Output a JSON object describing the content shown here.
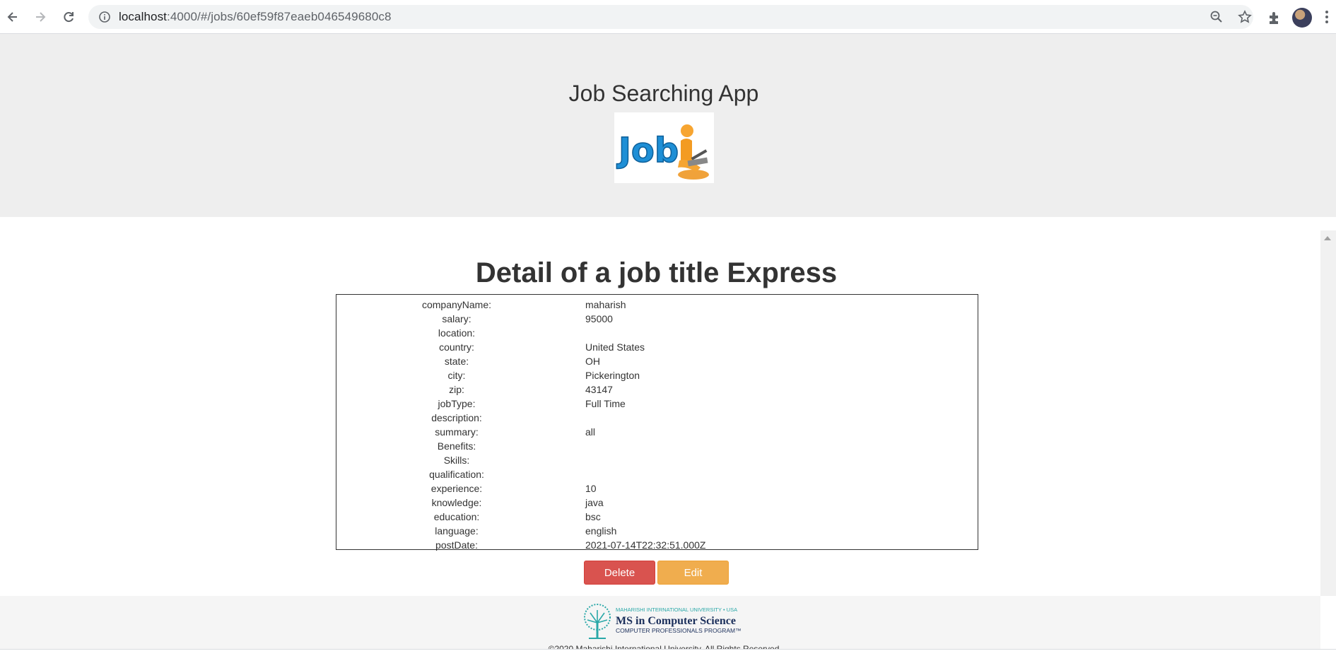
{
  "browser": {
    "url_host": "localhost",
    "url_path": ":4000/#/jobs/60ef59f87eaeb046549680c8"
  },
  "header": {
    "title": "Job Searching App",
    "logo_text": "Job"
  },
  "main": {
    "heading": "Detail of a job title Express",
    "fields": [
      {
        "label": "companyName:",
        "value": "maharish"
      },
      {
        "label": "salary:",
        "value": "95000"
      },
      {
        "label": "location:",
        "value": ""
      },
      {
        "label": "country:",
        "value": "United States"
      },
      {
        "label": "state:",
        "value": "OH"
      },
      {
        "label": "city:",
        "value": "Pickerington"
      },
      {
        "label": "zip:",
        "value": "43147"
      },
      {
        "label": "jobType:",
        "value": "Full Time"
      },
      {
        "label": "description:",
        "value": ""
      },
      {
        "label": "summary:",
        "value": "all"
      },
      {
        "label": "Benefits:",
        "value": ""
      },
      {
        "label": "Skills:",
        "value": ""
      },
      {
        "label": "qualification:",
        "value": ""
      },
      {
        "label": "experience:",
        "value": "10"
      },
      {
        "label": "knowledge:",
        "value": "java"
      },
      {
        "label": "education:",
        "value": "bsc"
      },
      {
        "label": "language:",
        "value": "english"
      },
      {
        "label": "postDate:",
        "value": "2021-07-14T22:32:51.000Z"
      }
    ],
    "delete_label": "Delete",
    "edit_label": "Edit"
  },
  "footer": {
    "university_line": "MAHARISHI INTERNATIONAL UNIVERSITY • USA",
    "program_title": "MS in Computer Science",
    "program_sub": "COMPUTER PROFESSIONALS PROGRAM™",
    "copyright": "©2020 Maharishi International University. All Rights Reserved"
  },
  "colors": {
    "header_bg": "#eeeeee",
    "delete": "#d9534f",
    "edit": "#f0ad4e",
    "footer_bg": "#f5f5f5"
  }
}
